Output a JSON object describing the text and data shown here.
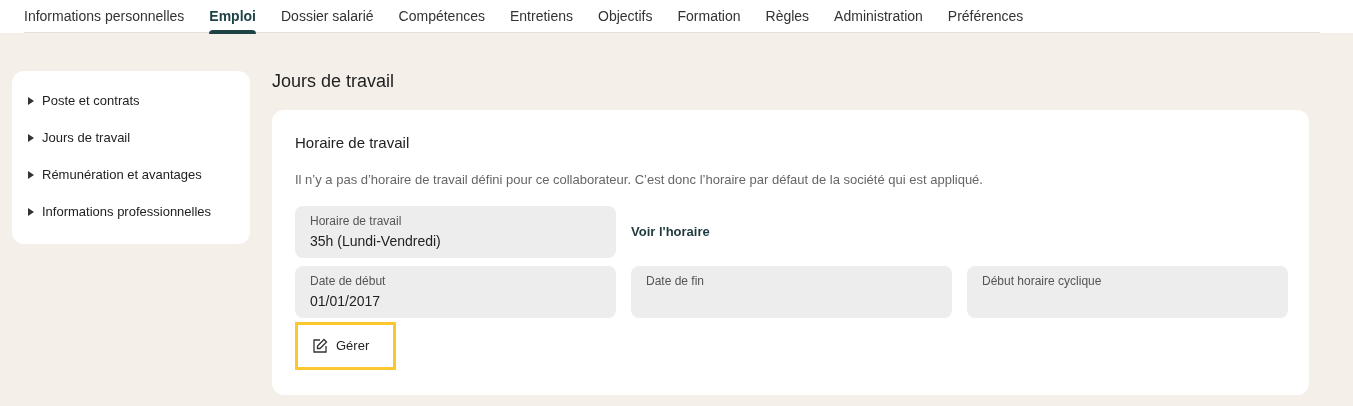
{
  "tabs": [
    {
      "label": "Informations personnelles",
      "selected": false
    },
    {
      "label": "Emploi",
      "selected": true
    },
    {
      "label": "Dossier salarié",
      "selected": false
    },
    {
      "label": "Compétences",
      "selected": false
    },
    {
      "label": "Entretiens",
      "selected": false
    },
    {
      "label": "Objectifs",
      "selected": false
    },
    {
      "label": "Formation",
      "selected": false
    },
    {
      "label": "Règles",
      "selected": false
    },
    {
      "label": "Administration",
      "selected": false
    },
    {
      "label": "Préférences",
      "selected": false
    }
  ],
  "sidebar": {
    "items": [
      {
        "label": "Poste et contrats"
      },
      {
        "label": "Jours de travail"
      },
      {
        "label": "Rémunération et avantages"
      },
      {
        "label": "Informations professionnelles"
      }
    ]
  },
  "page_title": "Jours de travail",
  "card": {
    "title": "Horaire de travail",
    "description": "Il n’y a pas d’horaire de travail défini pour ce collaborateur. C’est donc l’horaire par défaut de la société qui est appliqué.",
    "schedule_field": {
      "label": "Horaire de travail",
      "value": "35h (Lundi-Vendredi)"
    },
    "schedule_link": "Voir l'horaire",
    "date_fields": [
      {
        "label": "Date de début",
        "value": "01/01/2017"
      },
      {
        "label": "Date de fin"
      },
      {
        "label": "Début horaire cyclique"
      }
    ],
    "manage_button": {
      "label": "Gérer",
      "focused": true
    }
  }
}
